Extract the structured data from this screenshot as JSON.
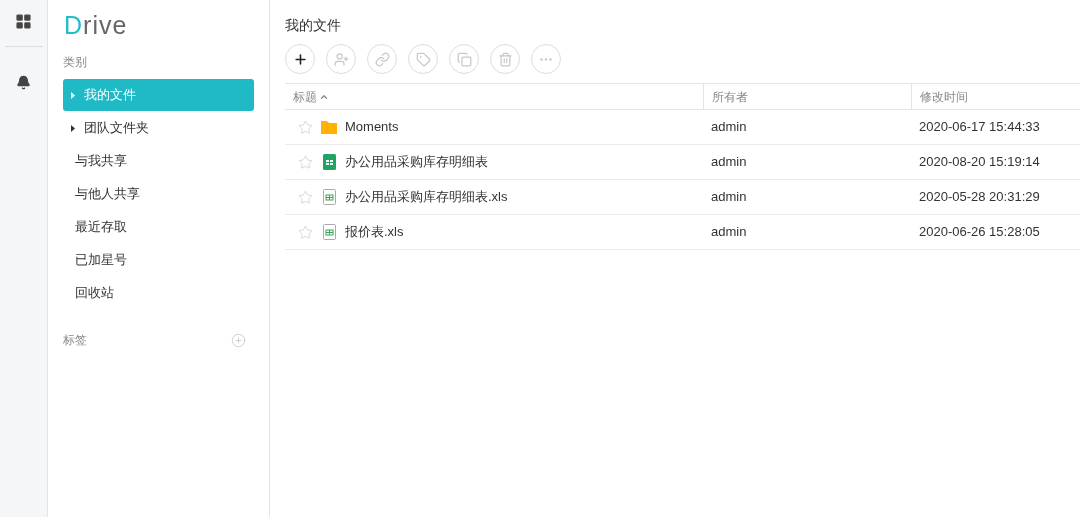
{
  "logo": "Drive",
  "sidebar": {
    "category_label": "类别",
    "items": [
      {
        "label": "我的文件",
        "expandable": true,
        "selected": true
      },
      {
        "label": "团队文件夹",
        "expandable": true,
        "selected": false
      },
      {
        "label": "与我共享",
        "expandable": false,
        "selected": false
      },
      {
        "label": "与他人共享",
        "expandable": false,
        "selected": false
      },
      {
        "label": "最近存取",
        "expandable": false,
        "selected": false
      },
      {
        "label": "已加星号",
        "expandable": false,
        "selected": false
      },
      {
        "label": "回收站",
        "expandable": false,
        "selected": false
      }
    ],
    "tags_label": "标签"
  },
  "main": {
    "title": "我的文件",
    "toolbar": [
      {
        "kind": "add",
        "disabled": false
      },
      {
        "kind": "share",
        "disabled": true
      },
      {
        "kind": "link",
        "disabled": true
      },
      {
        "kind": "tag",
        "disabled": true
      },
      {
        "kind": "copy",
        "disabled": true
      },
      {
        "kind": "delete",
        "disabled": true
      },
      {
        "kind": "more",
        "disabled": true
      }
    ],
    "table": {
      "columns": [
        {
          "label": "标题",
          "sorted": true
        },
        {
          "label": "所有者",
          "sorted": false
        },
        {
          "label": "修改时间",
          "sorted": false
        }
      ],
      "rows": [
        {
          "kind": "folder",
          "starred": false,
          "title": "Moments",
          "owner": "admin",
          "modified": "2020-06-17 15:44:33"
        },
        {
          "kind": "sheet",
          "starred": false,
          "title": "办公用品采购库存明细表",
          "owner": "admin",
          "modified": "2020-08-20 15:19:14"
        },
        {
          "kind": "xls",
          "starred": false,
          "title": "办公用品采购库存明细表.xls",
          "owner": "admin",
          "modified": "2020-05-28 20:31:29"
        },
        {
          "kind": "xls",
          "starred": false,
          "title": "报价表.xls",
          "owner": "admin",
          "modified": "2020-06-26 15:28:05"
        }
      ]
    }
  }
}
